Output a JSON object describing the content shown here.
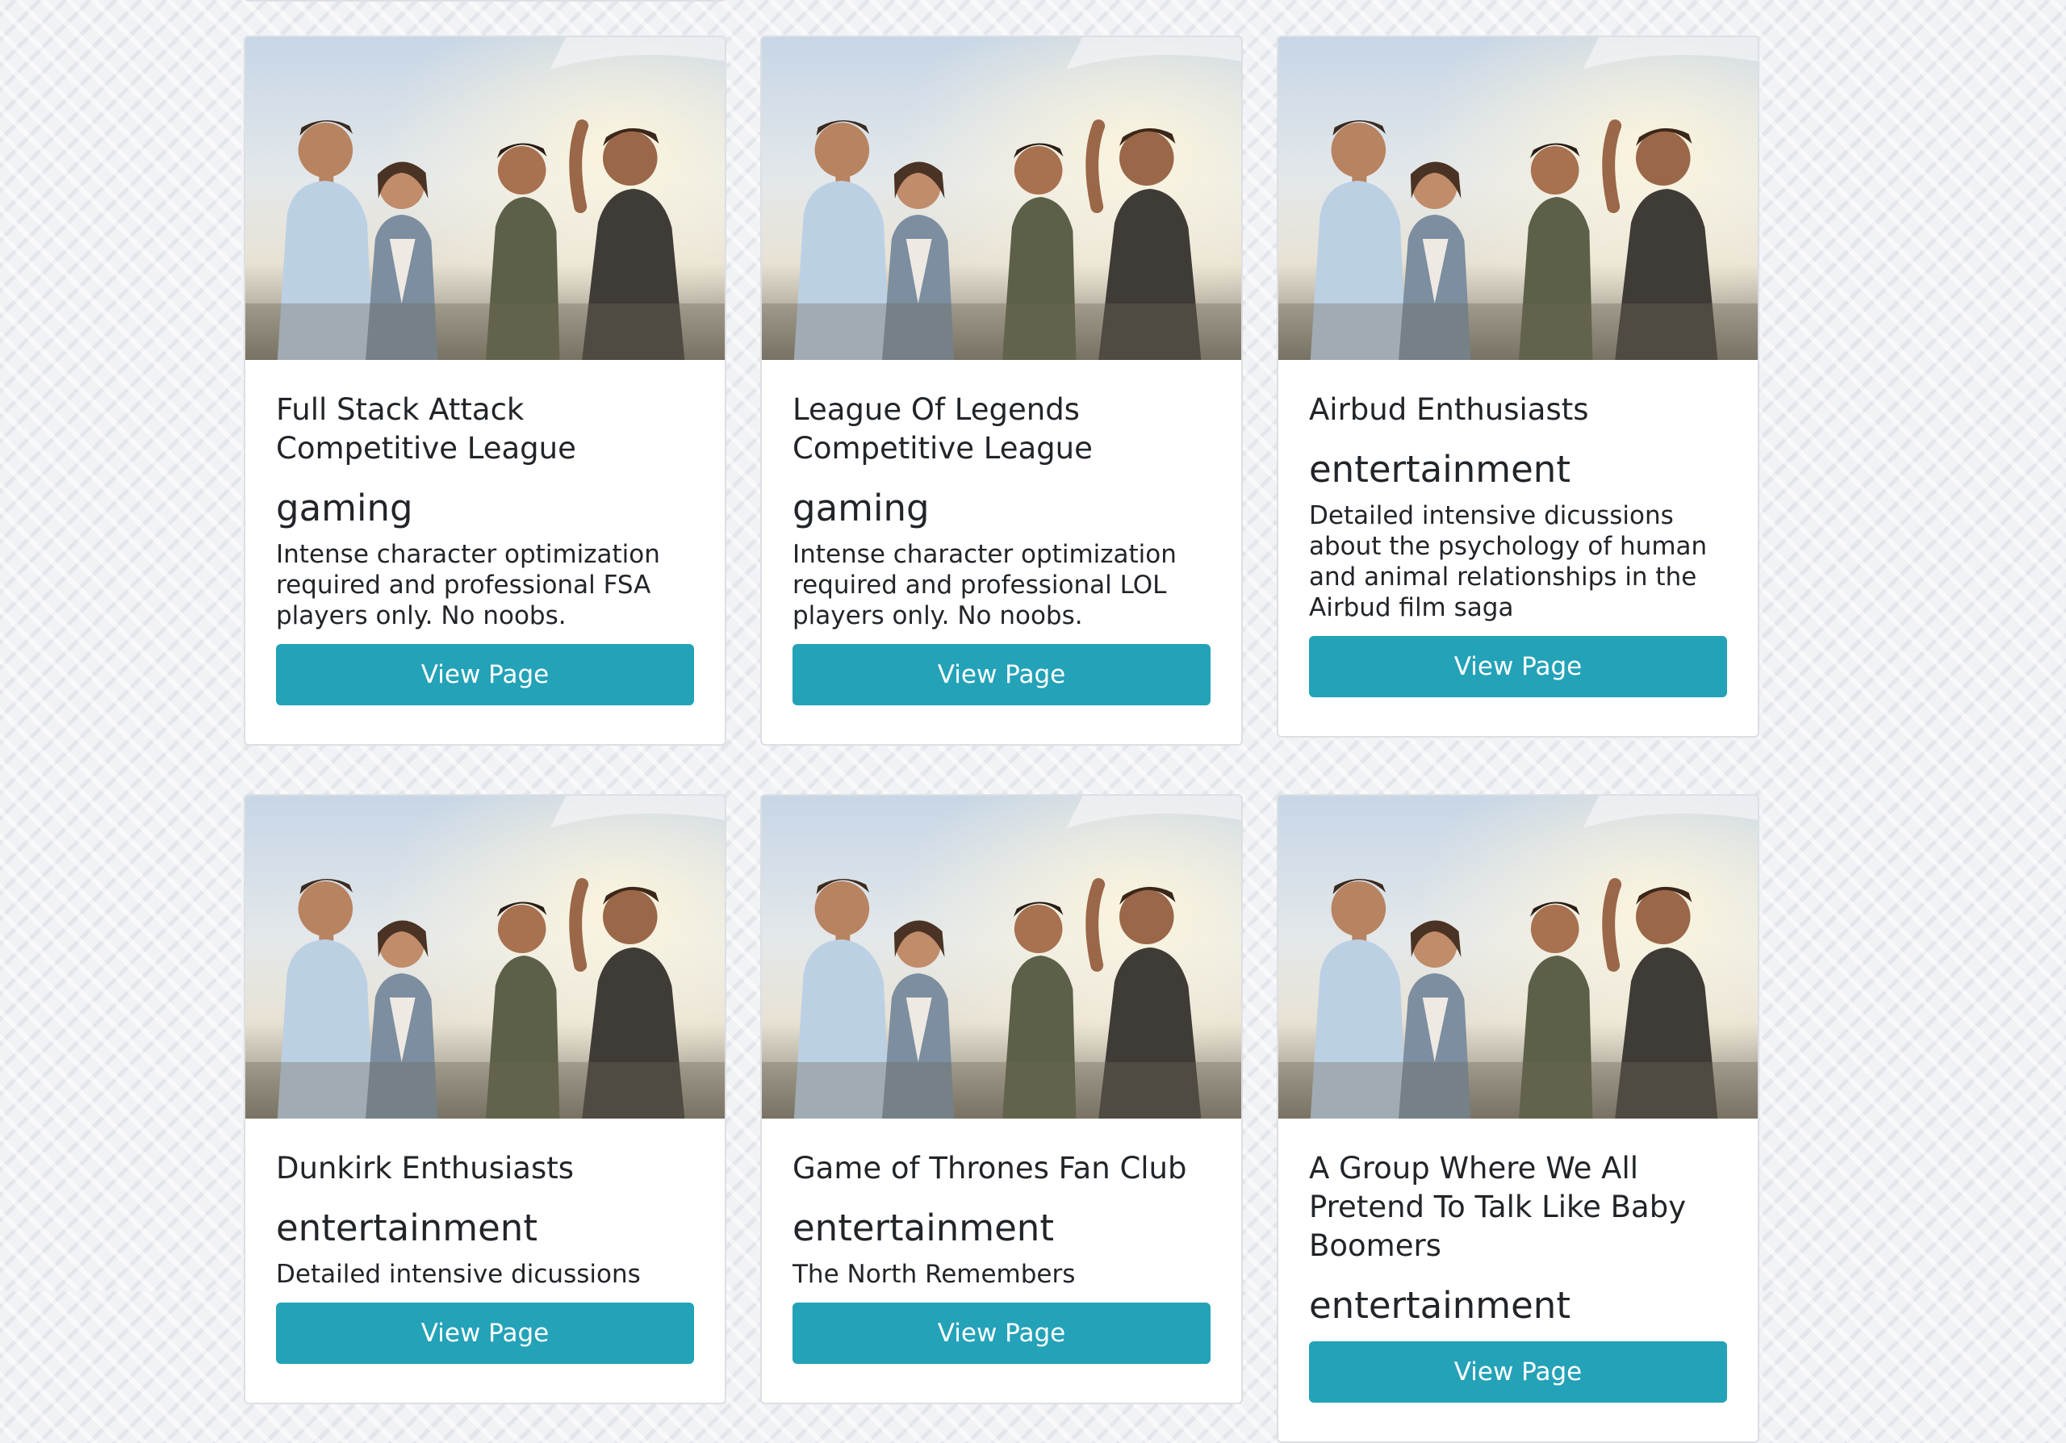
{
  "groups": [
    {
      "title": "Full Stack Attack Competitive League",
      "category": "gaming",
      "description": "Intense character optimization required and professional FSA players only. No noobs.",
      "button_label": "View Page"
    },
    {
      "title": "League Of Legends Competitive League",
      "category": "gaming",
      "description": "Intense character optimization required and professional LOL players only. No noobs.",
      "button_label": "View Page"
    },
    {
      "title": "Airbud Enthusiasts",
      "category": "entertainment",
      "description": "Detailed intensive dicussions about the psychology of human and animal relationships in the Airbud film saga",
      "button_label": "View Page"
    },
    {
      "title": "Dunkirk Enthusiasts",
      "category": "entertainment",
      "description": "Detailed intensive dicussions",
      "button_label": "View Page"
    },
    {
      "title": "Game of Thrones Fan Club",
      "category": "entertainment",
      "description": "The North Remembers",
      "button_label": "View Page"
    },
    {
      "title": "A Group Where We All Pretend To Talk Like Baby Boomers",
      "category": "entertainment",
      "description": "",
      "button_label": "View Page"
    }
  ],
  "colors": {
    "button_bg": "#23a2b8",
    "button_text": "#ffffff",
    "card_bg": "#ffffff",
    "card_border": "#dcdfe3",
    "text": "#212529"
  },
  "icons": {
    "card_image": "group-photo-friends-outdoors"
  }
}
